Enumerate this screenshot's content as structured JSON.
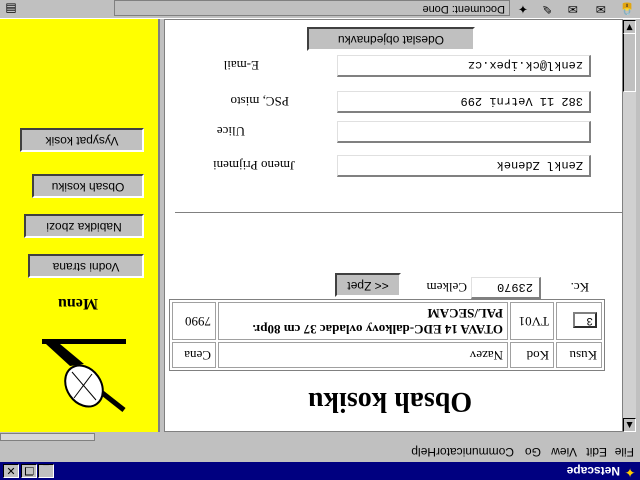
{
  "window": {
    "title": "Netscape"
  },
  "menubar": [
    "File",
    "Edit",
    "View",
    "Go",
    "Communicator",
    "Help"
  ],
  "status": {
    "text": "Document: Done"
  },
  "page": {
    "heading": "Obsah kosiku",
    "table": {
      "headers": [
        "Kusu",
        "Kod",
        "Nazev",
        "Cena"
      ],
      "rows": [
        {
          "qty": "3",
          "code": "TV01",
          "name": "OTAVA 14 EDC-dalkovy ovladac  37 cm 80pr. PAL/SECAM",
          "price": "7990"
        }
      ]
    },
    "back_button": "<< Zpet",
    "total": {
      "label": "Celkem",
      "value": "23970",
      "currency": "Kc."
    },
    "form": {
      "name_label": "Jmeno Prijmeni",
      "name_value": "Zenkl Zdenek",
      "street_label": "Ulice",
      "street_value": "",
      "city_label": "PSC, misto",
      "city_value": "382 11 Vetrni 299",
      "email_label": "E-mail",
      "email_value": "zenkl@ck.ipex.cz"
    },
    "submit_button": "Odeslat objednavku"
  },
  "menu": {
    "title": "Menu",
    "items": [
      "Vodni strana",
      "Nabidka zbozi",
      "Obsah kosiku",
      "Vysypat kosik"
    ]
  }
}
